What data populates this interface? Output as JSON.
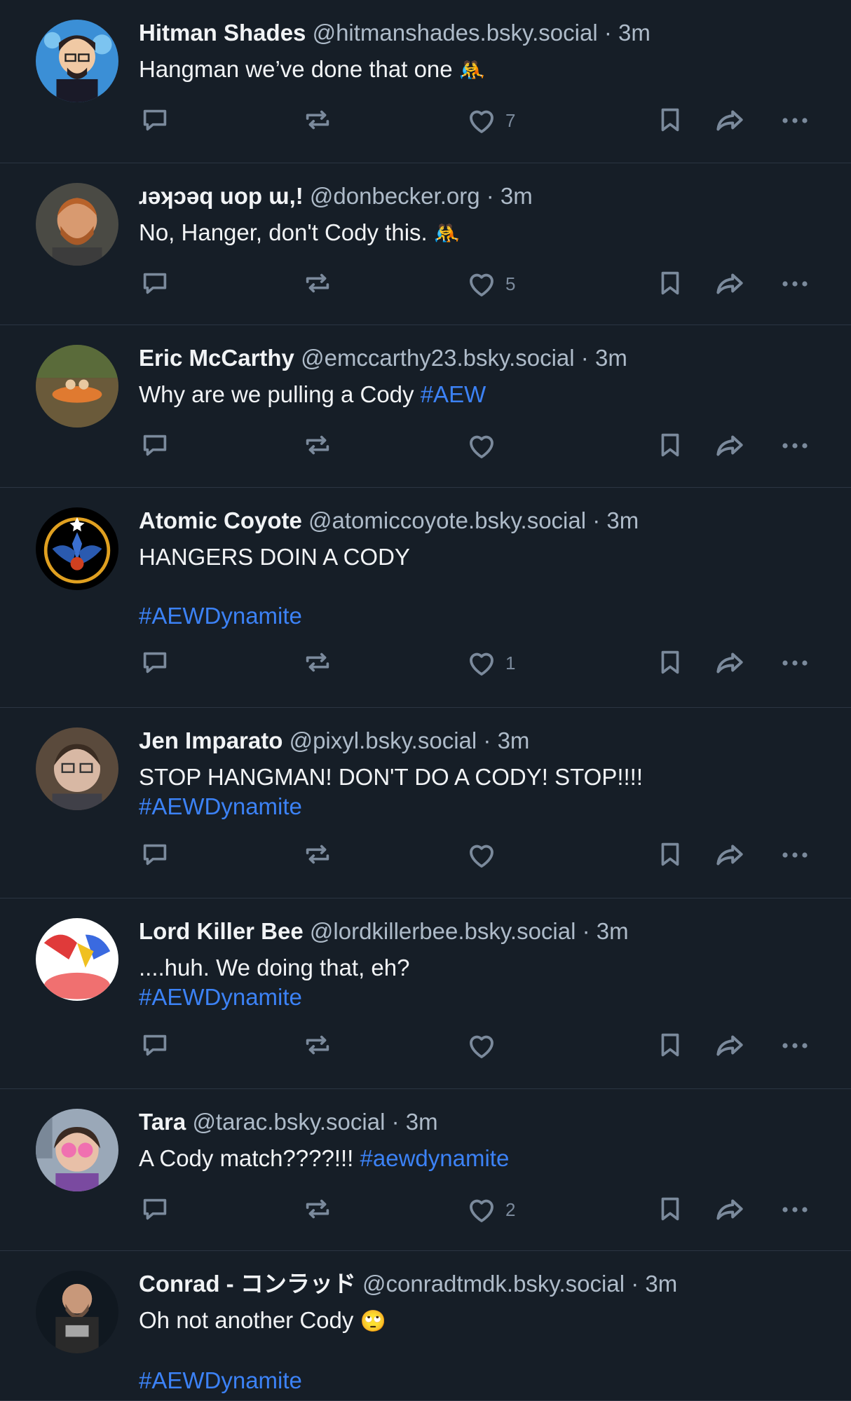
{
  "colors": {
    "background": "#161e27",
    "divider": "#2b3542",
    "text": "#f1f3f5",
    "muted": "#aebbc9",
    "icon": "#7b8a9c",
    "hashtag": "#3c82f6"
  },
  "posts": [
    {
      "name": "Hitman Shades",
      "handle": "@hitmanshades.bsky.social",
      "time": "3m",
      "text": "Hangman we’ve done that one",
      "emoji": "🤼",
      "tags": [],
      "likes": "7",
      "avatar": "avatar-cartoon-man"
    },
    {
      "name": "ɹǝʞɔǝq uop ɯ,!",
      "handle": "@donbecker.org",
      "time": "3m",
      "text": "No, Hanger, don't Cody this.",
      "emoji": "🤼",
      "tags": [],
      "likes": "5",
      "avatar": "avatar-bearded-man"
    },
    {
      "name": "Eric McCarthy",
      "handle": "@emccarthy23.bsky.social",
      "time": "3m",
      "text": "Why are we pulling a Cody",
      "inline_tag": "#AEW",
      "tags": [],
      "likes": "",
      "avatar": "avatar-raft-photo"
    },
    {
      "name": "Atomic Coyote",
      "handle": "@atomiccoyote.bsky.social",
      "time": "3m",
      "text": "HANGERS DOIN A CODY",
      "tags": [
        "#AEWDynamite"
      ],
      "tag_gap": true,
      "likes": "1",
      "avatar": "avatar-eagle-emblem"
    },
    {
      "name": "Jen Imparato",
      "handle": "@pixyl.bsky.social",
      "time": "3m",
      "text": "STOP HANGMAN! DON'T DO A CODY! STOP!!!!",
      "tags": [
        "#AEWDynamite"
      ],
      "likes": "",
      "avatar": "avatar-glasses-person"
    },
    {
      "name": "Lord Killer Bee",
      "handle": "@lordkillerbee.bsky.social",
      "time": "3m",
      "text": "....huh. We doing that, eh?",
      "tags": [
        "#AEWDynamite"
      ],
      "likes": "",
      "avatar": "avatar-drawing"
    },
    {
      "name": "Tara",
      "handle": "@tarac.bsky.social",
      "time": "3m",
      "text": "A Cody match????!!!",
      "inline_tag": "#aewdynamite",
      "tags": [],
      "likes": "2",
      "avatar": "avatar-pink-glasses"
    },
    {
      "name": "Conrad - コンラッド",
      "handle": "@conradtmdk.bsky.social",
      "time": "3m",
      "text": "Oh not another Cody",
      "emoji": "🙄",
      "tags": [
        "#AEWDynamite"
      ],
      "tag_gap": true,
      "likes": "",
      "avatar": "avatar-abolish-ice-shirt"
    }
  ],
  "icons": {
    "reply": "reply-icon",
    "repost": "repost-icon",
    "like": "heart-icon",
    "bookmark": "bookmark-icon",
    "share": "share-icon",
    "more": "more-icon"
  },
  "separator": "·"
}
